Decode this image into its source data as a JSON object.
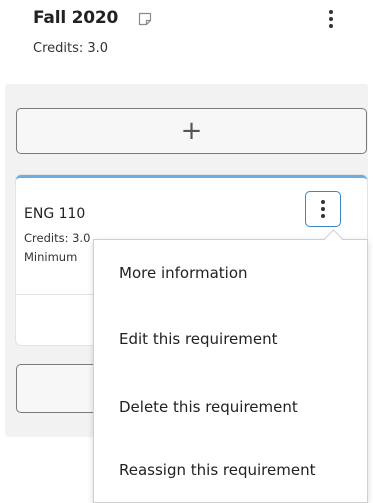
{
  "term": {
    "title": "Fall 2020",
    "credits": "Credits: 3.0",
    "icons": {
      "note": "note-icon",
      "menu": "kebab-menu-icon"
    }
  },
  "add_button": {
    "icon": "plus-icon",
    "symbol": "+"
  },
  "course": {
    "code": "ENG 110",
    "credits": "Credits: 3.0",
    "minimum": "Minimum",
    "menu_icon": "kebab-menu-icon",
    "accent_color": "#6aaee6",
    "menu_button_border": "#3a87c8"
  },
  "menu": {
    "items": [
      {
        "label": "More information"
      },
      {
        "label": "Edit this requirement"
      },
      {
        "label": "Delete this requirement"
      },
      {
        "label": "Reassign this requirement"
      }
    ]
  }
}
